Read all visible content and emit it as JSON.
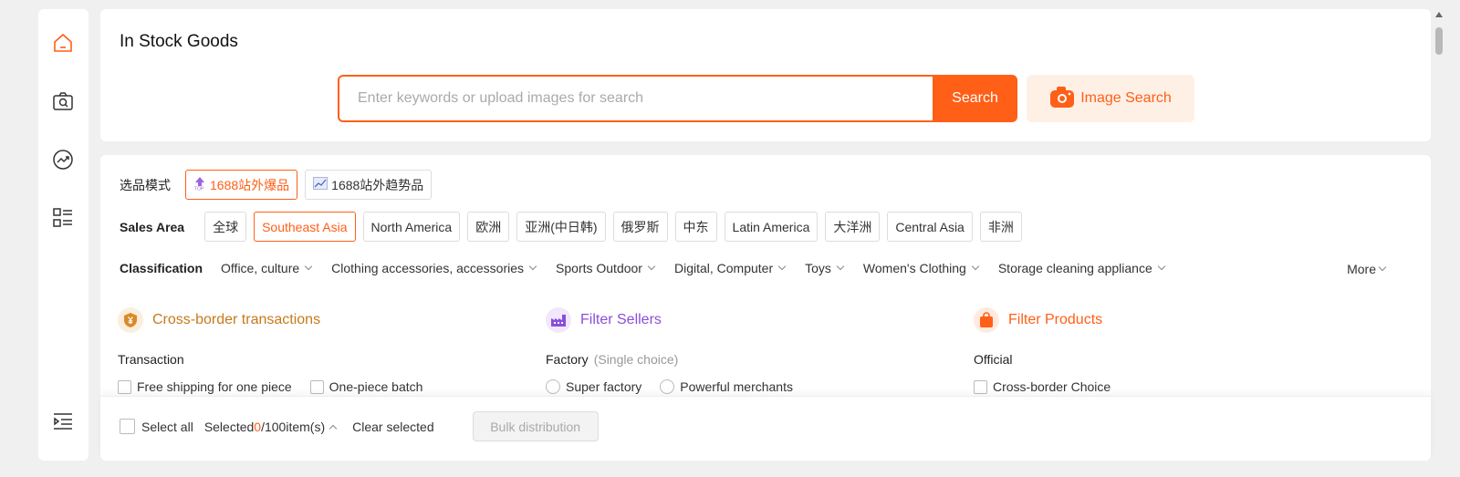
{
  "header": {
    "title": "In Stock Goods"
  },
  "search": {
    "placeholder": "Enter keywords or upload images for search",
    "button": "Search",
    "image_button": "Image Search"
  },
  "mode": {
    "label": "选品模式",
    "options": [
      "1688站外爆品",
      "1688站外趋势品"
    ],
    "active": 0
  },
  "sales_area": {
    "label": "Sales Area",
    "options": [
      "全球",
      "Southeast Asia",
      "North America",
      "欧洲",
      "亚洲(中日韩)",
      "俄罗斯",
      "中东",
      "Latin America",
      "大洋洲",
      "Central Asia",
      "非洲"
    ],
    "active": 1
  },
  "classification": {
    "label": "Classification",
    "items": [
      "Office, culture",
      "Clothing accessories, accessories",
      "Sports Outdoor",
      "Digital, Computer",
      "Toys",
      "Women's Clothing",
      "Storage cleaning appliance"
    ],
    "more": "More"
  },
  "filters": {
    "cross_border": {
      "title": "Cross-border transactions",
      "sub": "Transaction",
      "options": [
        "Free shipping for one piece",
        "One-piece batch"
      ]
    },
    "sellers": {
      "title": "Filter Sellers",
      "sub": "Factory",
      "hint": "(Single choice)",
      "options": [
        "Super factory",
        "Powerful merchants"
      ]
    },
    "products": {
      "title": "Filter Products",
      "sub": "Official",
      "options": [
        "Cross-border Choice"
      ]
    }
  },
  "bottom": {
    "select_all": "Select all",
    "selected_prefix": "Selected ",
    "selected_count": "0",
    "selected_suffix": "/100item(s)",
    "clear": "Clear selected",
    "bulk": "Bulk distribution"
  },
  "colors": {
    "accent": "#ff5f17",
    "cross_border": "#c77a1a",
    "sellers": "#8a4fd8",
    "products": "#ff5f17"
  }
}
